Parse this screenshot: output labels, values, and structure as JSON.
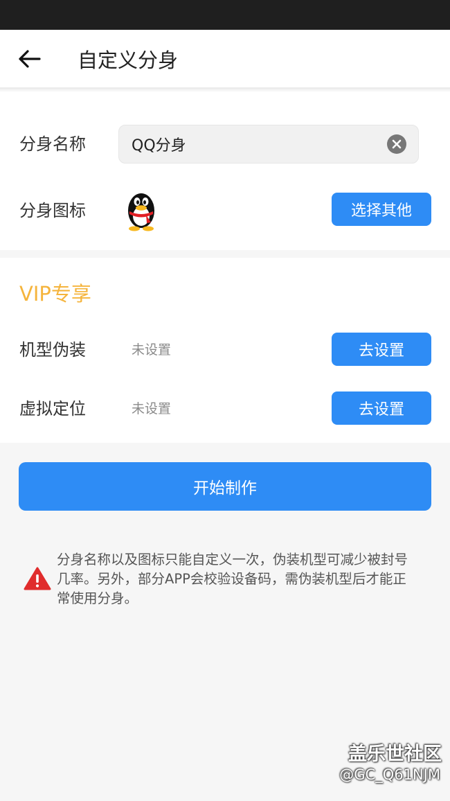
{
  "app_bar": {
    "title": "自定义分身"
  },
  "basic": {
    "name_label": "分身名称",
    "name_value": "QQ分身",
    "icon_label": "分身图标",
    "icon_name": "qq-penguin-icon",
    "choose_other_label": "选择其他"
  },
  "vip": {
    "title": "VIP专享",
    "device_disguise_label": "机型伪装",
    "device_disguise_status": "未设置",
    "virtual_location_label": "虚拟定位",
    "virtual_location_status": "未设置",
    "set_button_label": "去设置"
  },
  "start_button_label": "开始制作",
  "notice": "分身名称以及图标只能自定义一次，伪装机型可减少被封号几率。另外，部分APP会校验设备码，需伪装机型后才能正常使用分身。",
  "watermark": {
    "site": "盖乐世社区",
    "user": "@GC_Q61NJM"
  },
  "colors": {
    "accent": "#2e8cf5",
    "vip": "#f5b43c",
    "warning": "#e02c2c"
  }
}
